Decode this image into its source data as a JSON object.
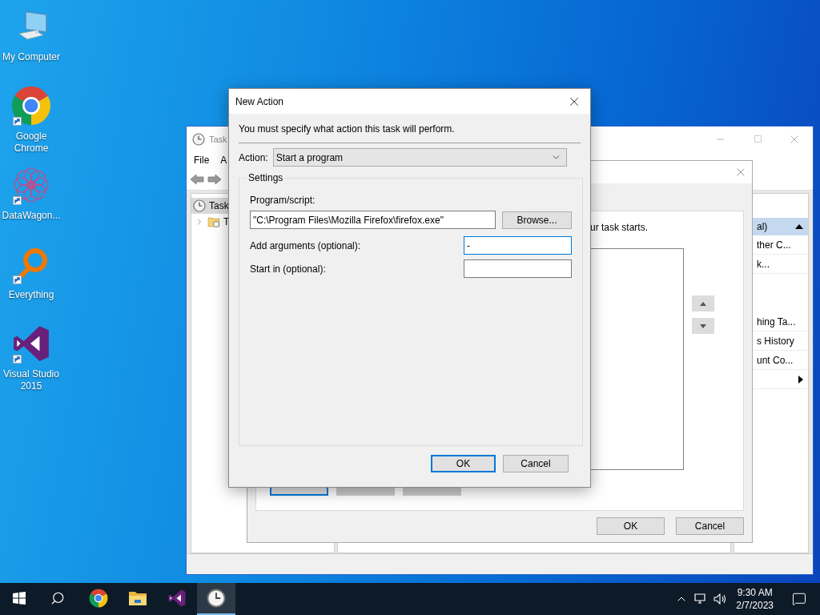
{
  "desktop_icons": [
    {
      "label": "My Computer",
      "kind": "computer",
      "shortcut": false
    },
    {
      "label": "Google Chrome",
      "kind": "chrome",
      "shortcut": true
    },
    {
      "label": "DataWagon...",
      "kind": "datawagon",
      "shortcut": true
    },
    {
      "label": "Everything",
      "kind": "everything",
      "shortcut": true
    },
    {
      "label": "Visual Studio 2015",
      "kind": "vs",
      "shortcut": true
    }
  ],
  "task_scheduler": {
    "title": "Task",
    "menu": [
      "File",
      "A"
    ],
    "tree": {
      "label": "Task",
      "selected": true,
      "children": [
        {
          "label": "T",
          "expanded": false
        }
      ]
    },
    "actions_pane": {
      "header": "al)",
      "expanded": true,
      "sections": [
        [
          {
            "kind": "action",
            "label": "ther C..."
          },
          {
            "kind": "action",
            "label": "k..."
          }
        ],
        [
          {
            "kind": "action",
            "label": "hing Ta..."
          },
          {
            "kind": "action",
            "label": "s History"
          },
          {
            "kind": "action",
            "label": "unt Co..."
          },
          {
            "kind": "submenu"
          }
        ]
      ]
    }
  },
  "create_task": {
    "hint": "ur task starts.",
    "buttons_row": [
      {
        "disabled": false
      },
      {
        "disabled": true
      },
      {
        "disabled": true
      }
    ],
    "ok": "OK",
    "cancel": "Cancel"
  },
  "new_action": {
    "title": "New Action",
    "instruction": "You must specify what action this task will perform.",
    "action_label": "Action:",
    "action_value": "Start a program",
    "group": "Settings",
    "program_label": "Program/script:",
    "program_value": "\"C:\\Program Files\\Mozilla Firefox\\firefox.exe\"",
    "browse": "Browse...",
    "args_label": "Add arguments (optional):",
    "args_value": "-",
    "args_focused": true,
    "start_label": "Start in (optional):",
    "ok": "OK",
    "cancel": "Cancel"
  },
  "taskbar": {
    "apps": [
      {
        "kind": "chrome",
        "active": false
      },
      {
        "kind": "folder",
        "active": false
      },
      {
        "kind": "vs",
        "active": false
      },
      {
        "kind": "scheduler",
        "active": true
      }
    ],
    "time": "9:30 AM",
    "date": "2/7/2023"
  }
}
